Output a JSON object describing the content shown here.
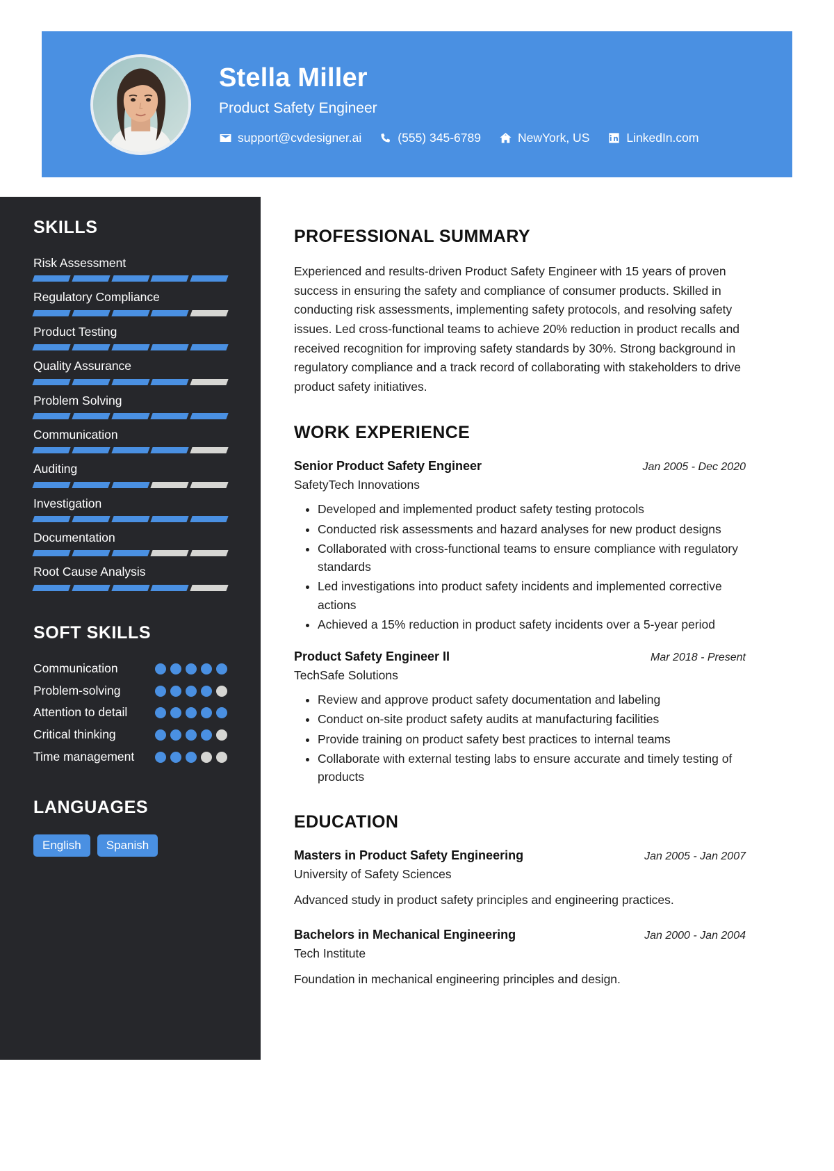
{
  "theme": {
    "accent": "#4a90e2",
    "sidebar_bg": "#26272b",
    "track": "#d6d6d3",
    "page_bg": "#ffffff"
  },
  "header": {
    "name": "Stella Miller",
    "role": "Product Safety Engineer",
    "avatar_alt": "profile-photo",
    "contacts": [
      {
        "icon": "envelope-icon",
        "label": "support@cvdesigner.ai"
      },
      {
        "icon": "phone-icon",
        "label": "(555) 345-6789"
      },
      {
        "icon": "home-icon",
        "label": "NewYork, US"
      },
      {
        "icon": "linkedin-icon",
        "label": "LinkedIn.com"
      }
    ]
  },
  "sidebar": {
    "skills_heading": "SKILLS",
    "skills_max": 5,
    "skills": [
      {
        "name": "Risk Assessment",
        "level": 5
      },
      {
        "name": "Regulatory Compliance",
        "level": 4
      },
      {
        "name": "Product Testing",
        "level": 5
      },
      {
        "name": "Quality Assurance",
        "level": 4
      },
      {
        "name": "Problem Solving",
        "level": 5
      },
      {
        "name": "Communication",
        "level": 4
      },
      {
        "name": "Auditing",
        "level": 3
      },
      {
        "name": "Investigation",
        "level": 5
      },
      {
        "name": "Documentation",
        "level": 3
      },
      {
        "name": "Root Cause Analysis",
        "level": 4
      }
    ],
    "soft_skills_heading": "SOFT SKILLS",
    "soft_skills_max": 5,
    "soft_skills": [
      {
        "name": "Communication",
        "level": 5
      },
      {
        "name": "Problem-solving",
        "level": 4
      },
      {
        "name": "Attention to detail",
        "level": 5
      },
      {
        "name": "Critical thinking",
        "level": 4
      },
      {
        "name": "Time management",
        "level": 3
      }
    ],
    "languages_heading": "LANGUAGES",
    "languages": [
      "English",
      "Spanish"
    ]
  },
  "main": {
    "summary_heading": "PROFESSIONAL SUMMARY",
    "summary_text": "Experienced and results-driven Product Safety Engineer with 15 years of proven success in ensuring the safety and compliance of consumer products. Skilled in conducting risk assessments, implementing safety protocols, and resolving safety issues. Led cross-functional teams to achieve 20% reduction in product recalls and received recognition for improving safety standards by 30%. Strong background in regulatory compliance and a track record of collaborating with stakeholders to drive product safety initiatives.",
    "work_heading": "WORK EXPERIENCE",
    "work": [
      {
        "title": "Senior Product Safety Engineer",
        "date": "Jan 2005 - Dec 2020",
        "org": "SafetyTech Innovations",
        "bullets": [
          "Developed and implemented product safety testing protocols",
          "Conducted risk assessments and hazard analyses for new product designs",
          "Collaborated with cross-functional teams to ensure compliance with regulatory standards",
          "Led investigations into product safety incidents and implemented corrective actions",
          "Achieved a 15% reduction in product safety incidents over a 5-year period"
        ]
      },
      {
        "title": "Product Safety Engineer II",
        "date": "Mar 2018 - Present",
        "org": "TechSafe Solutions",
        "bullets": [
          "Review and approve product safety documentation and labeling",
          "Conduct on-site product safety audits at manufacturing facilities",
          "Provide training on product safety best practices to internal teams",
          "Collaborate with external testing labs to ensure accurate and timely testing of products"
        ]
      }
    ],
    "education_heading": "EDUCATION",
    "education": [
      {
        "title": "Masters in Product Safety Engineering",
        "date": "Jan 2005 - Jan 2007",
        "org": "University of Safety Sciences",
        "desc": "Advanced study in product safety principles and engineering practices."
      },
      {
        "title": "Bachelors in Mechanical Engineering",
        "date": "Jan 2000 - Jan 2004",
        "org": "Tech Institute",
        "desc": "Foundation in mechanical engineering principles and design."
      }
    ]
  }
}
